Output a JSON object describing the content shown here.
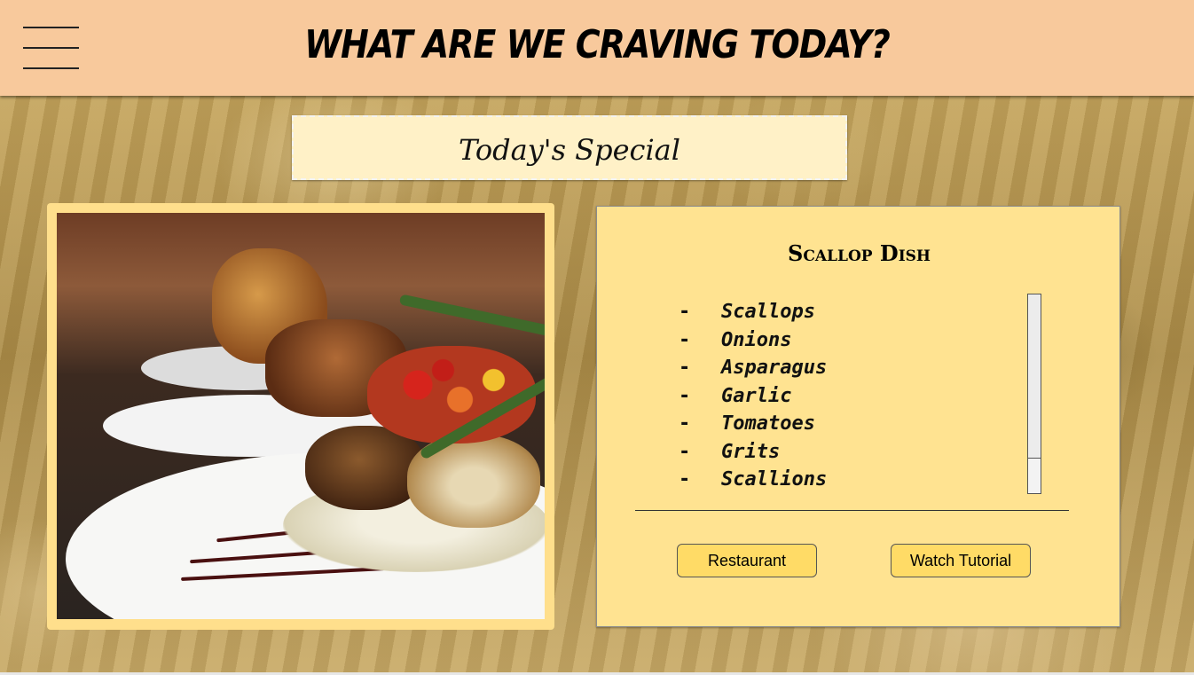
{
  "header": {
    "title": "WHAT ARE WE CRAVING TODAY?",
    "menu_icon": "hamburger-menu-icon"
  },
  "banner": {
    "text": "Today's Special"
  },
  "photo": {
    "subject": "food-photo"
  },
  "recipe": {
    "title": "Scallop Dish",
    "ingredients": [
      {
        "dash": "-",
        "name": "Scallops"
      },
      {
        "dash": "-",
        "name": "Onions"
      },
      {
        "dash": "-",
        "name": "Asparagus"
      },
      {
        "dash": "-",
        "name": "Garlic"
      },
      {
        "dash": "-",
        "name": "Tomatoes"
      },
      {
        "dash": "-",
        "name": "Grits"
      },
      {
        "dash": "-",
        "name": "Scallions"
      }
    ],
    "buttons": {
      "restaurant": "Restaurant",
      "tutorial": "Watch Tutorial"
    }
  },
  "colors": {
    "header_bg": "#f8c99c",
    "banner_bg": "#fff1c7",
    "card_bg": "#ffe391",
    "button_bg": "#ffdb66",
    "photo_frame": "#ffdf8c"
  }
}
